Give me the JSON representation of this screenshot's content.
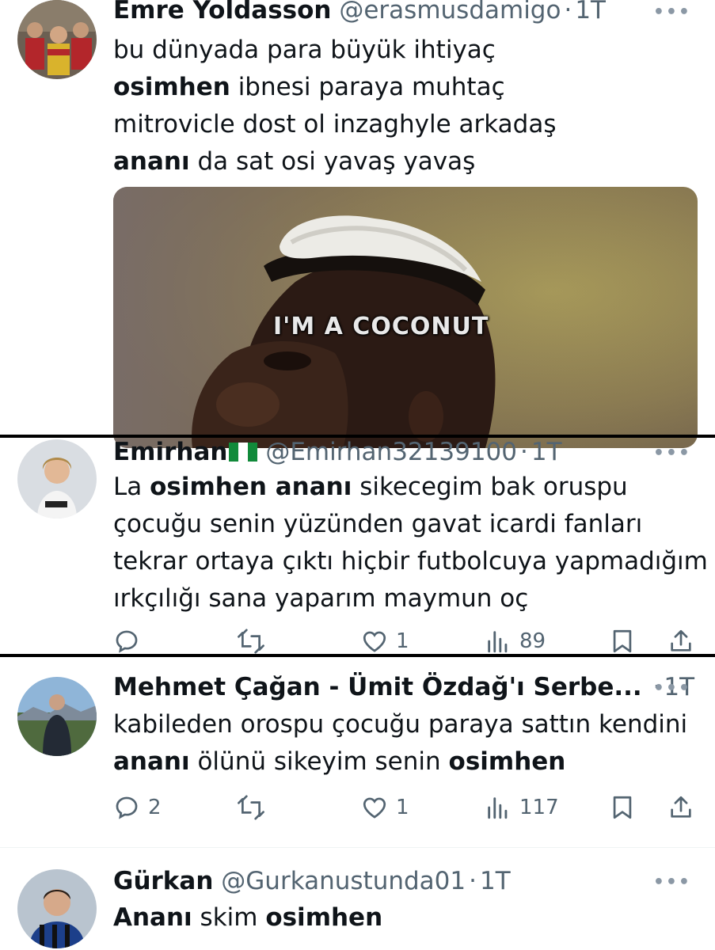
{
  "tweets": [
    {
      "name": "Emre Yoldasson",
      "handle": "@erasmusdamigo",
      "time": "1T",
      "lines": [
        [
          {
            "t": "bu dünyada para büyük ihtiyaç",
            "b": false
          }
        ],
        [
          {
            "t": "osimhen",
            "b": true
          },
          {
            "t": " ibnesi paraya muhtaç",
            "b": false
          }
        ],
        [
          {
            "t": "mitrovicle dost ol inzaghyle arkadaş",
            "b": false
          }
        ],
        [
          {
            "t": "ananı",
            "b": true
          },
          {
            "t": " da sat osi yavaş yavaş",
            "b": false
          }
        ]
      ],
      "media_caption": "I'M A COCONUT"
    },
    {
      "name": "Emirhan",
      "flag": "nigeria-flag",
      "handle": "@Emirhan32139100",
      "time": "1T",
      "lines": [
        [
          {
            "t": "La ",
            "b": false
          },
          {
            "t": "osimhen ananı",
            "b": true
          },
          {
            "t": " sikecegim bak oruspu",
            "b": false
          }
        ],
        [
          {
            "t": "çocuğu senin yüzünden gavat icardi fanları",
            "b": false
          }
        ],
        [
          {
            "t": "tekrar ortaya çıktı hiçbir futbolcuya yapmadığım",
            "b": false
          }
        ],
        [
          {
            "t": "ırkçılığı sana yaparım maymun oç",
            "b": false
          }
        ]
      ],
      "actions": {
        "reply": "",
        "retweet": "",
        "like": "1",
        "views": "89"
      }
    },
    {
      "name": "Mehmet Çağan - Ümit Özdağ'ı Serbe...",
      "handle": "",
      "time": "1T",
      "lines": [
        [
          {
            "t": "kabileden orospu çocuğu  paraya sattın kendini",
            "b": false
          }
        ],
        [
          {
            "t": "ananı",
            "b": true
          },
          {
            "t": " ölünü sikeyim senin ",
            "b": false
          },
          {
            "t": "osimhen",
            "b": true
          }
        ]
      ],
      "actions": {
        "reply": "2",
        "retweet": "",
        "like": "1",
        "views": "117"
      }
    },
    {
      "name": "Gürkan",
      "handle": "@Gurkanustunda01",
      "time": "1T",
      "lines": [
        [
          {
            "t": "Ananı",
            "b": true
          },
          {
            "t": " skim ",
            "b": false
          },
          {
            "t": "osimhen",
            "b": true
          }
        ]
      ]
    }
  ],
  "separator": "·",
  "more_label": "•••",
  "icons": [
    "reply-icon",
    "retweet-icon",
    "like-icon",
    "views-icon",
    "bookmark-icon",
    "share-icon",
    "more-icon"
  ]
}
